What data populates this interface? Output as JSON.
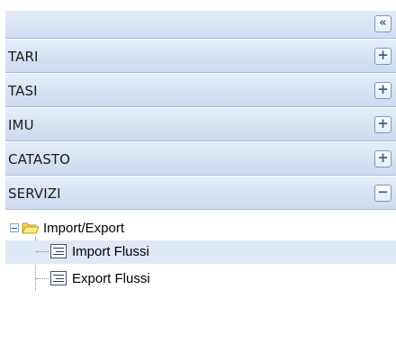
{
  "panel": {
    "collapse_button": "«"
  },
  "accordion": {
    "items": [
      {
        "label": "TARI",
        "state": "collapsed",
        "toggle": "+"
      },
      {
        "label": "TASI",
        "state": "collapsed",
        "toggle": "+"
      },
      {
        "label": "IMU",
        "state": "collapsed",
        "toggle": "+"
      },
      {
        "label": "CATASTO",
        "state": "collapsed",
        "toggle": "+"
      },
      {
        "label": "SERVIZI",
        "state": "expanded",
        "toggle": "−"
      }
    ]
  },
  "tree": {
    "root": {
      "label": "Import/Export",
      "icon": "folder-open-icon",
      "expanded": true
    },
    "children": [
      {
        "label": "Import Flussi",
        "icon": "list-icon",
        "selected": true
      },
      {
        "label": "Export Flussi",
        "icon": "list-icon",
        "selected": false
      }
    ]
  },
  "colors": {
    "header_bg": "#d4e0f3",
    "border": "#a9bfd6",
    "selection": "#dfe8f6"
  }
}
